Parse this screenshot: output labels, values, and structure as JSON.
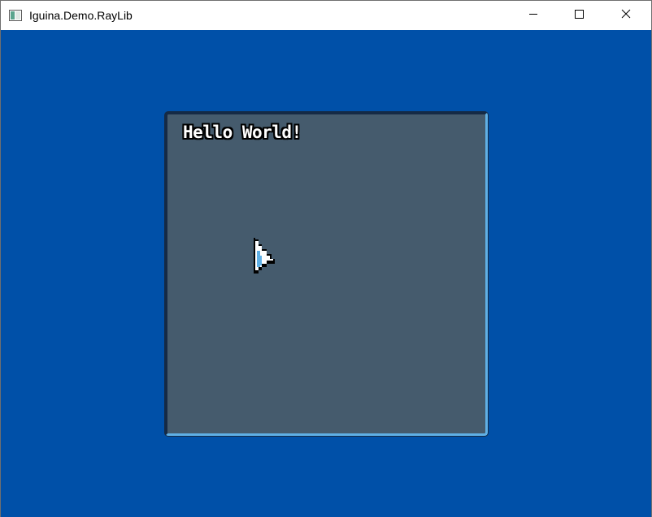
{
  "window": {
    "title": "Iguina.Demo.RayLib",
    "controls": {
      "minimize": "minimize-icon",
      "maximize": "maximize-icon",
      "close": "close-icon"
    }
  },
  "canvas": {
    "background_color": "#0050a8",
    "panel": {
      "label": "Hello World!",
      "background_color": "#455b6d",
      "border_dark_color": "#152a45",
      "border_light_color": "#5fb0e6"
    },
    "cursor": {
      "icon": "arrow-cursor-icon"
    }
  }
}
